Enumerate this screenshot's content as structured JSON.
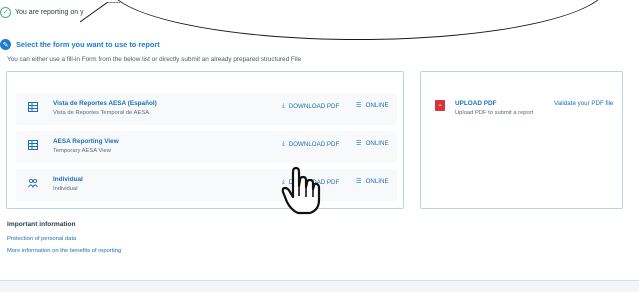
{
  "banner": {
    "text": "You are reporting on y"
  },
  "step": {
    "title": "Select the form you want to use to report"
  },
  "intro": "You can either use a fill-in Form from the below list or directly submit an already prepared structured File",
  "forms": [
    {
      "name": "Vista de Reportes AESA (Español)",
      "subtitle": "Vista de Reportes Temporal de AESA",
      "download_label": "DOWNLOAD PDF",
      "online_label": "ONLINE",
      "icon": "form-grid-icon"
    },
    {
      "name": "AESA Reporting View",
      "subtitle": "Temporary AESA View",
      "download_label": "DOWNLOAD PDF",
      "online_label": "ONLINE",
      "icon": "form-grid-icon"
    },
    {
      "name": "Individual",
      "subtitle": "Individual",
      "download_label": "DOWNLOAD PDF",
      "online_label": "ONLINE",
      "icon": "people-icon"
    }
  ],
  "upload": {
    "title": "UPLOAD PDF",
    "subtitle": "Upload PDF to submit a report",
    "validate_label": "Validate your PDF file",
    "icon": "pdf-icon"
  },
  "info": {
    "title": "Important information",
    "links": [
      "Protection of personal data",
      "More information on the benefits of reporting"
    ]
  },
  "colors": {
    "accent": "#1f6fb8",
    "step": "#1f7bd1",
    "pdf": "#d9343a",
    "border": "#b9d3ea"
  }
}
